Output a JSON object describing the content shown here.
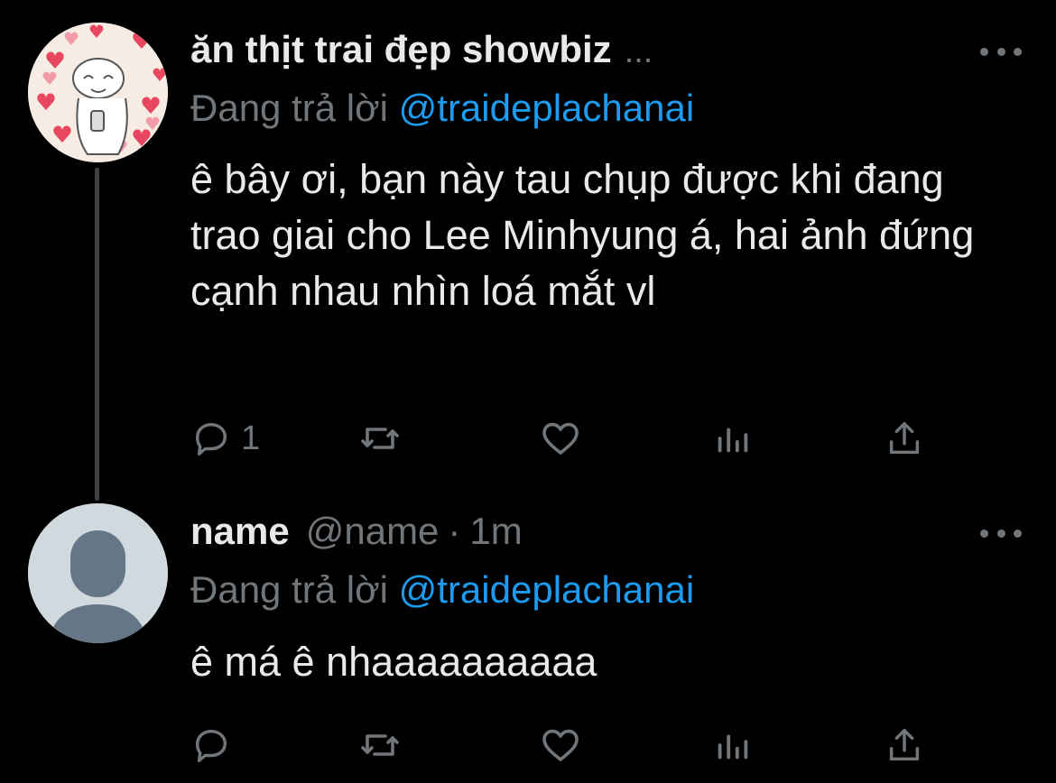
{
  "tweets": [
    {
      "display_name": "ăn thịt trai đẹp showbiz",
      "name_ellipsis": "...",
      "reply_prefix": "Đang trả lời",
      "reply_mention": "@traideplachanai",
      "text": "ê bây ơi, bạn này tau chụp được khi đang trao giai cho Lee Minhyung á, hai ảnh đứng cạnh nhau nhìn loá mắt vl",
      "reply_count": "1",
      "avatar_icon": "sticker-avatar-icon"
    },
    {
      "display_name": "name",
      "handle": "@name",
      "separator": "·",
      "time": "1m",
      "reply_prefix": "Đang trả lời",
      "reply_mention": "@traideplachanai",
      "text": "ê má ê nhaaaaaaaaaa",
      "avatar_icon": "default-avatar-icon"
    }
  ],
  "icons": {
    "reply": "comment-icon",
    "retweet": "retweet-icon",
    "like": "heart-icon",
    "views": "analytics-icon",
    "share": "share-icon",
    "more": "more-icon"
  },
  "colors": {
    "background": "#000000",
    "text": "#e7e9ea",
    "secondary": "#71767b",
    "link": "#1d9bf0",
    "thread_line": "#3e4144",
    "default_avatar_bg": "#cfd9de"
  }
}
